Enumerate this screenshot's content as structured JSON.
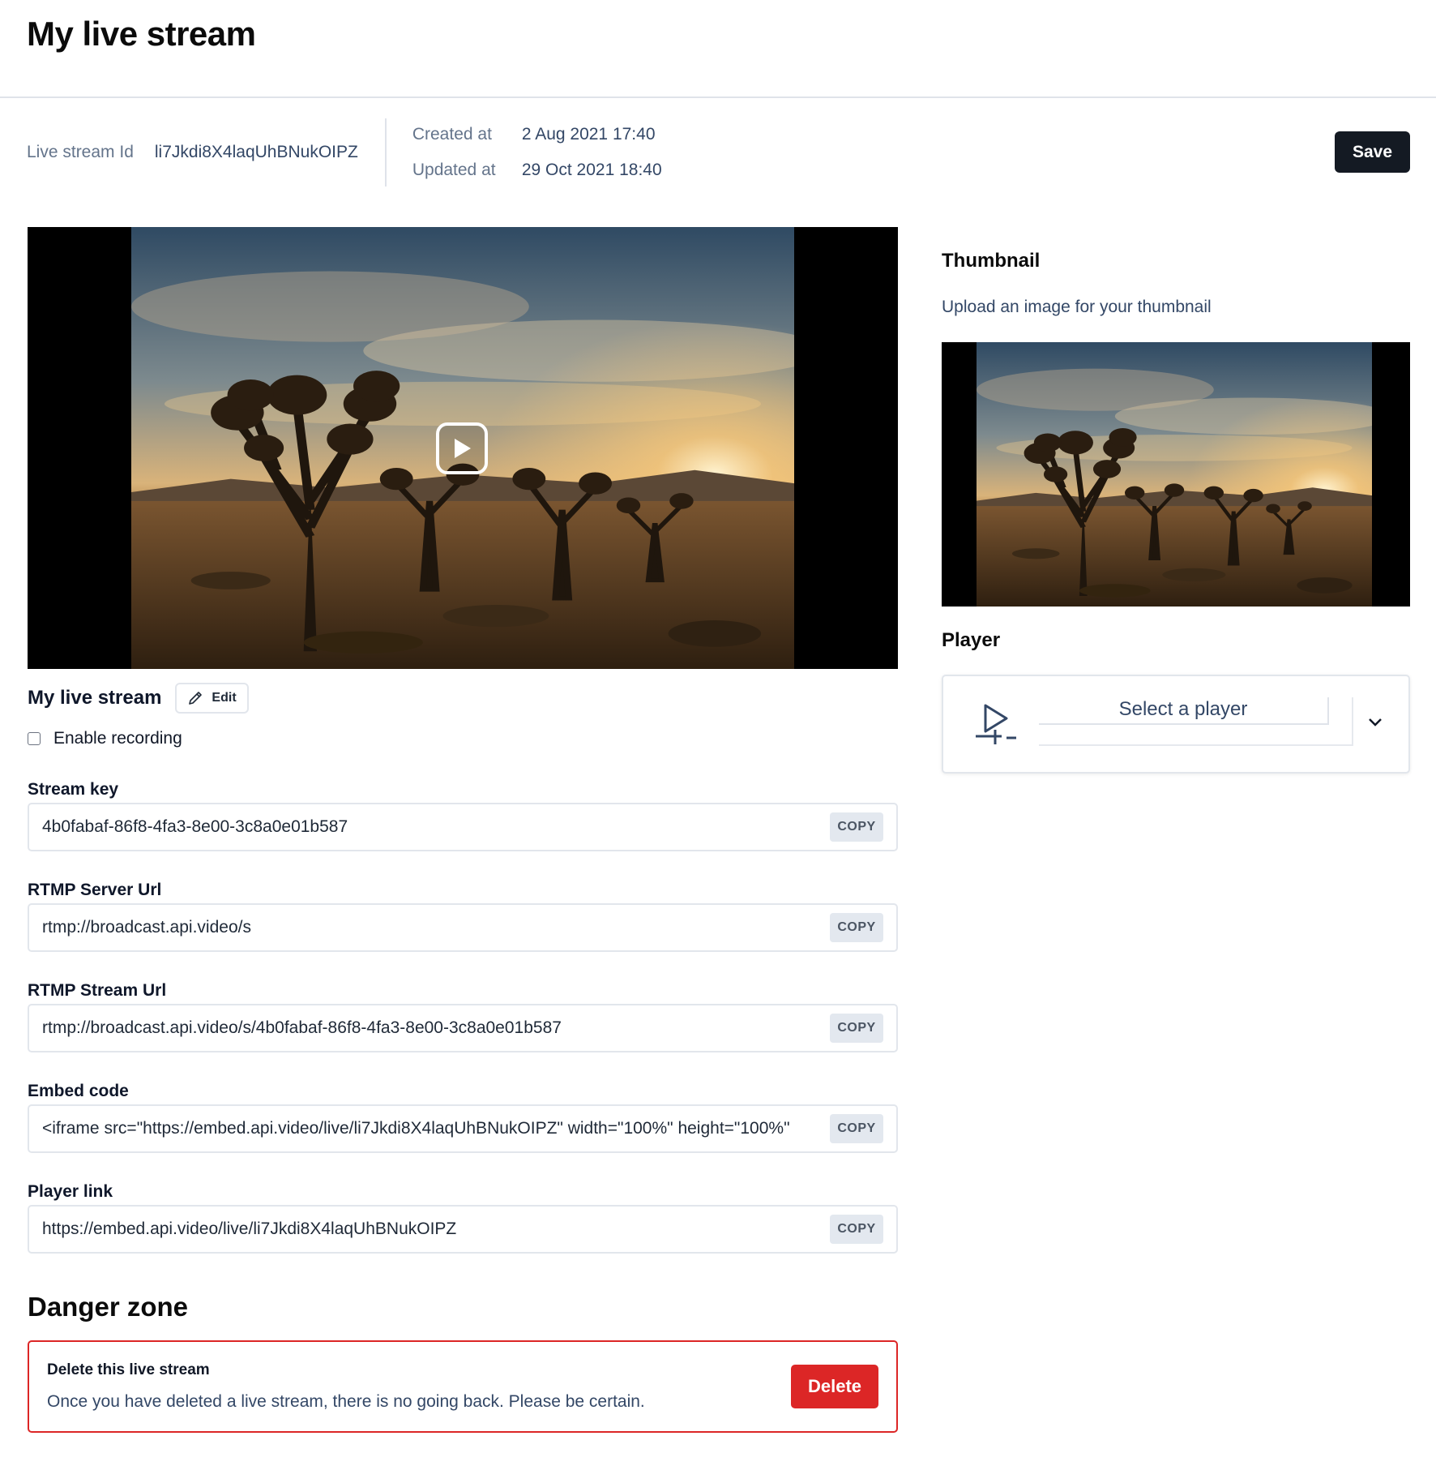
{
  "page": {
    "title": "My live stream"
  },
  "meta": {
    "id_label": "Live stream Id",
    "id_value": "li7Jkdi8X4laqUhBNukOIPZ",
    "created_label": "Created at",
    "created_value": "2 Aug 2021 17:40",
    "updated_label": "Updated at",
    "updated_value": "29 Oct 2021 18:40"
  },
  "toolbar": {
    "save_label": "Save"
  },
  "stream": {
    "name": "My live stream",
    "edit_label": "Edit",
    "recording_label": "Enable recording",
    "recording_checked": false
  },
  "fields": {
    "stream_key": {
      "label": "Stream key",
      "value": "4b0fabaf-86f8-4fa3-8e00-3c8a0e01b587",
      "copy_label": "COPY"
    },
    "rtmp_server": {
      "label": "RTMP Server Url",
      "value": "rtmp://broadcast.api.video/s",
      "copy_label": "COPY"
    },
    "rtmp_stream": {
      "label": "RTMP Stream Url",
      "value": "rtmp://broadcast.api.video/s/4b0fabaf-86f8-4fa3-8e00-3c8a0e01b587",
      "copy_label": "COPY"
    },
    "embed_code": {
      "label": "Embed code",
      "value": "<iframe src=\"https://embed.api.video/live/li7Jkdi8X4laqUhBNukOIPZ\" width=\"100%\" height=\"100%\"",
      "copy_label": "COPY"
    },
    "player_link": {
      "label": "Player link",
      "value": "https://embed.api.video/live/li7Jkdi8X4laqUhBNukOIPZ",
      "copy_label": "COPY"
    }
  },
  "danger": {
    "title": "Danger zone",
    "heading": "Delete this live stream",
    "description": "Once you have deleted a live stream, there is no going back. Please be certain.",
    "delete_label": "Delete"
  },
  "thumbnail": {
    "title": "Thumbnail",
    "subtitle": "Upload an image for your thumbnail"
  },
  "player": {
    "title": "Player",
    "select_placeholder": "Select a player"
  },
  "icons": {
    "play": "play-icon",
    "edit": "pencil-icon",
    "player": "player-icon",
    "chevron": "chevron-down-icon"
  },
  "colors": {
    "save_bg": "#141a23",
    "danger": "#dc2626",
    "copy_bg": "#e3e8ef",
    "muted_text": "#64748b"
  }
}
